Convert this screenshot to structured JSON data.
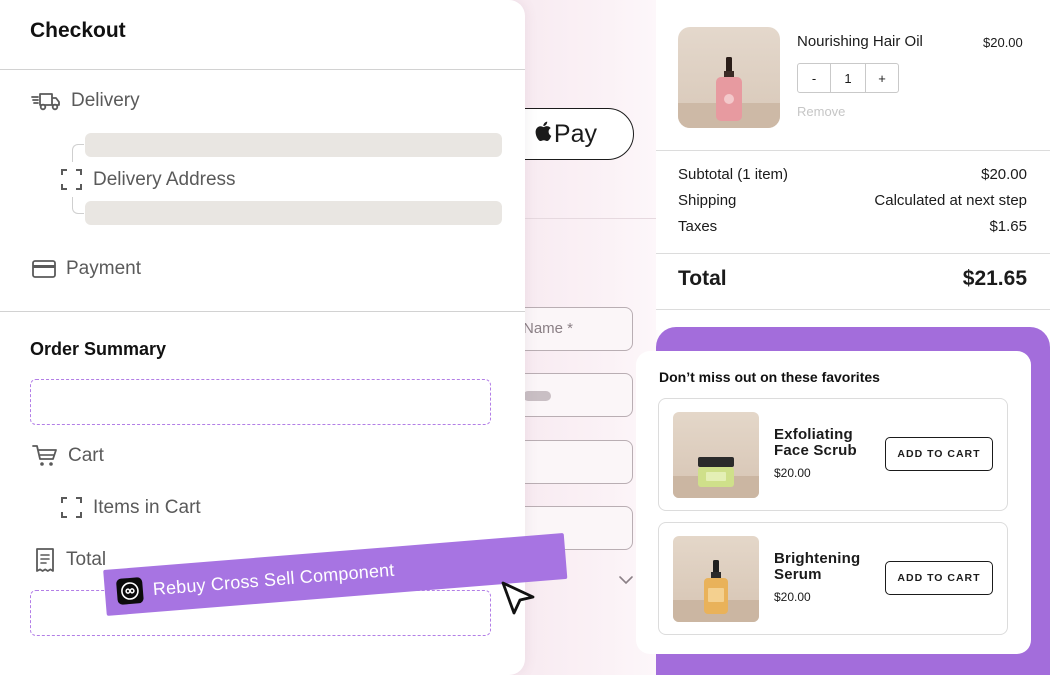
{
  "builder": {
    "title": "Checkout",
    "delivery_label": "Delivery",
    "delivery_address_label": "Delivery Address",
    "payment_label": "Payment",
    "order_summary_title": "Order Summary",
    "cart_label": "Cart",
    "items_in_cart_label": "Items in Cart",
    "total_label": "Total"
  },
  "checkout_form": {
    "pay_button_label": "Pay",
    "name_placeholder": "Name *"
  },
  "order": {
    "product_name": "Nourishing Hair Oil",
    "product_price": "$20.00",
    "quantity": "1",
    "decrement_label": "-",
    "increment_label": "+",
    "remove_label": "Remove",
    "subtotal_label": "Subtotal (1 item)",
    "subtotal_value": "$20.00",
    "shipping_label": "Shipping",
    "shipping_value": "Calculated at next step",
    "taxes_label": "Taxes",
    "taxes_value": "$1.65",
    "total_label": "Total",
    "total_value": "$21.65"
  },
  "cross_sell": {
    "title": "Don’t miss out on these favorites",
    "items": [
      {
        "name": "Exfoliating Face Scrub",
        "price": "$20.00",
        "button_label": "ADD TO CART"
      },
      {
        "name": "Brightening Serum",
        "price": "$20.00",
        "button_label": "ADD TO CART"
      }
    ]
  },
  "tag": {
    "label": "Rebuy Cross Sell Component"
  },
  "colors": {
    "accent_purple": "#a774e2",
    "dashed_border": "#b27ee6",
    "text_dark": "#1b1b1b",
    "muted_gray": "#5a5a5a"
  },
  "icons": [
    "truck-icon",
    "focus-frame-icon",
    "credit-card-icon",
    "shopping-cart-icon",
    "receipt-icon",
    "apple-icon",
    "chevron-down-icon",
    "infinity-icon",
    "cursor-arrow-icon"
  ]
}
